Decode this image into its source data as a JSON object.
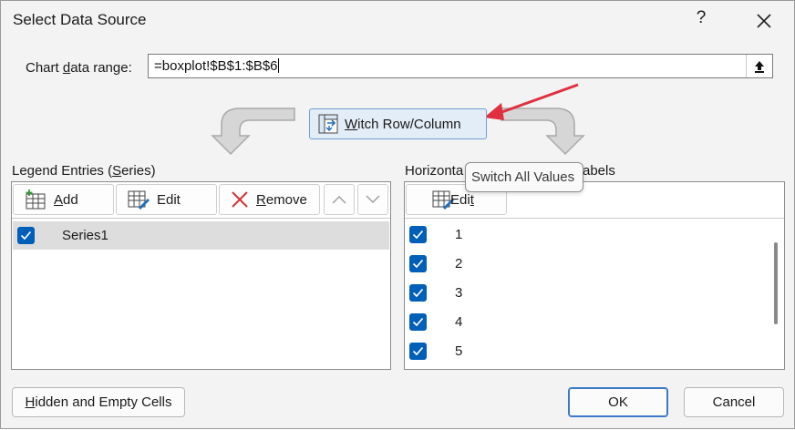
{
  "window": {
    "title": "Select Data Source",
    "help": "?"
  },
  "range": {
    "label_before": "Chart ",
    "label_accel": "d",
    "label_after": "ata range:",
    "value": "=boxplot!$B$1:$B$6"
  },
  "switch": {
    "accel": "W",
    "rest": "itch Row/Column"
  },
  "legend": {
    "label_before": "Legend Entries (",
    "label_accel": "S",
    "label_after": "eries)",
    "add": {
      "accel": "A",
      "rest": "dd"
    },
    "edit": "Edit",
    "remove": {
      "accel": "R",
      "rest": "emove"
    },
    "series": [
      {
        "name": "Series1",
        "checked": true
      }
    ]
  },
  "axis": {
    "label_left": "Horizonta",
    "label_right": "abels",
    "edit": {
      "before": "Edi",
      "accel": "t",
      "after": ""
    },
    "categories": [
      {
        "value": "1",
        "checked": true
      },
      {
        "value": "2",
        "checked": true
      },
      {
        "value": "3",
        "checked": true
      },
      {
        "value": "4",
        "checked": true
      },
      {
        "value": "5",
        "checked": true
      }
    ]
  },
  "tooltip": "Switch All Values",
  "buttons": {
    "hidden": {
      "accel": "H",
      "rest": "idden and Empty Cells"
    },
    "ok": "OK",
    "cancel": "Cancel"
  },
  "icons": {
    "close": "close-icon",
    "collapse": "collapse-dialog-icon",
    "switch": "switch-row-column-icon",
    "add": "add-series-icon",
    "edit": "edit-table-icon",
    "remove": "remove-x-icon",
    "up": "chevron-up-icon",
    "down": "chevron-down-icon",
    "check": "checkmark-icon"
  },
  "colors": {
    "accent": "#005fb8",
    "remove_red": "#d13438",
    "arrow_red": "#e0303f"
  }
}
